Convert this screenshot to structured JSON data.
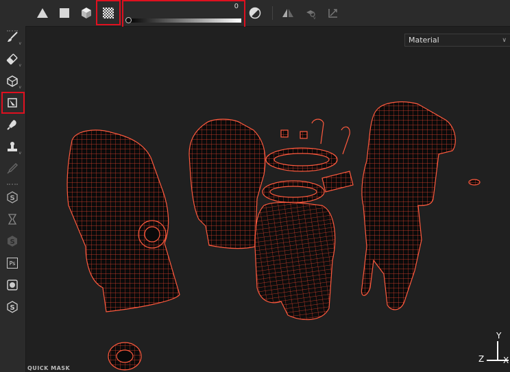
{
  "toolbar": {
    "tools": [
      {
        "name": "triangle-icon"
      },
      {
        "name": "square-icon"
      },
      {
        "name": "cube-icon"
      },
      {
        "name": "checker-icon"
      }
    ],
    "slider_value": "0",
    "right_tools": [
      {
        "name": "contrast-icon"
      },
      {
        "name": "symmetry-icon"
      },
      {
        "name": "settings-sub-icon"
      },
      {
        "name": "transform-icon"
      }
    ],
    "highlight_color": "#e0101f"
  },
  "left_tools": [
    {
      "name": "brush-icon"
    },
    {
      "name": "eraser-icon"
    },
    {
      "name": "projection-icon"
    },
    {
      "name": "polygon-fill-icon"
    },
    {
      "name": "smudge-icon"
    },
    {
      "name": "clone-icon"
    },
    {
      "name": "color-picker-icon"
    },
    {
      "name": "substance-icon"
    },
    {
      "name": "hourglass-icon"
    },
    {
      "name": "substance-dim-icon"
    },
    {
      "name": "photoshop-icon"
    },
    {
      "name": "export-icon"
    },
    {
      "name": "substance-share-icon"
    }
  ],
  "photoshop_label": "Ps",
  "viewport": {
    "display_mode": "Material",
    "mesh_color": "#e8432e",
    "axis": {
      "y": "Y",
      "z": "Z",
      "x": "X"
    },
    "footer": "QUICK MASK"
  }
}
